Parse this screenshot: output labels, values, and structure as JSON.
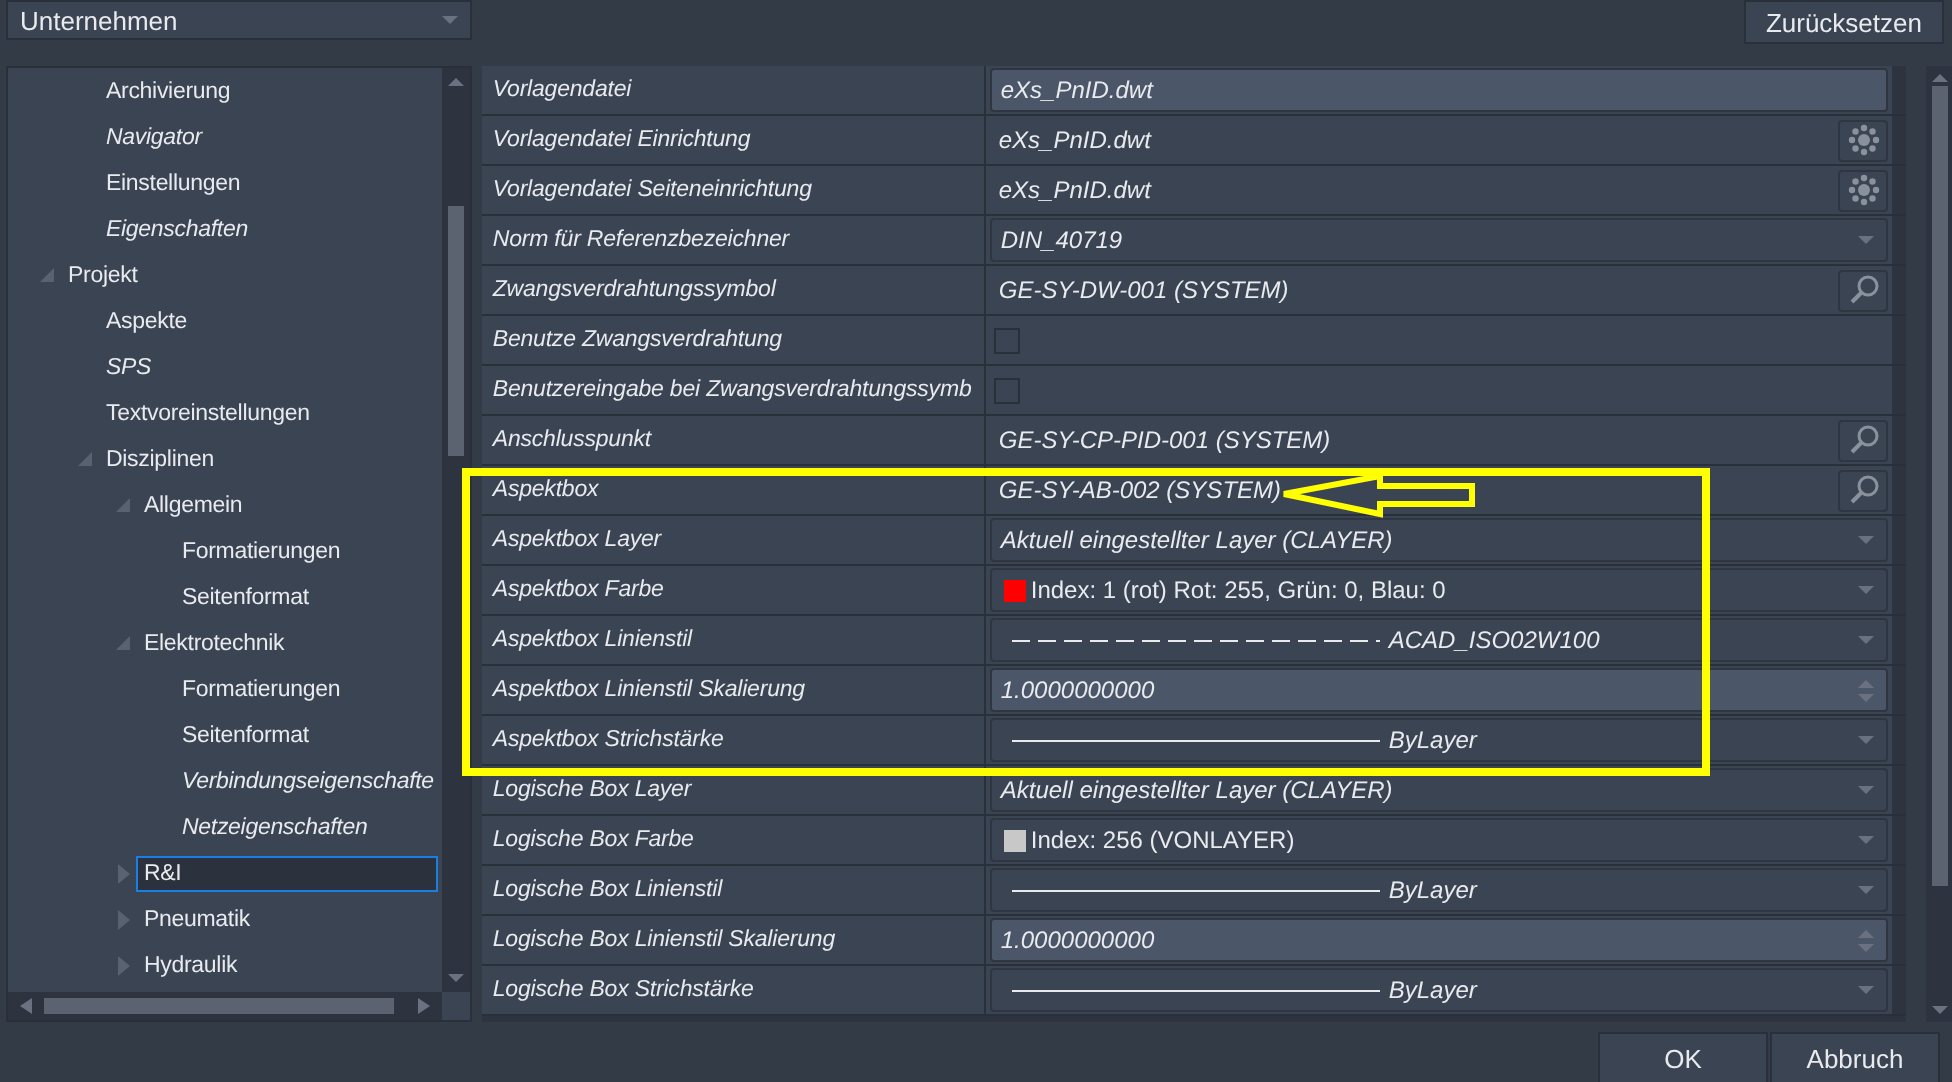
{
  "scope_dropdown": {
    "value": "Unternehmen"
  },
  "reset_button": "Zurücksetzen",
  "tree": {
    "continued_items": [
      {
        "label": "Archivierung",
        "italic": false,
        "selected": false
      },
      {
        "label": "Navigator",
        "italic": true,
        "selected": false
      },
      {
        "label": "Einstellungen",
        "italic": false,
        "selected": false
      },
      {
        "label": "Eigenschaften",
        "italic": true,
        "selected": false
      }
    ],
    "items": [
      {
        "label": "Projekt",
        "expanded": true,
        "italic": false,
        "selected": false,
        "children": [
          {
            "label": "Aspekte",
            "italic": false,
            "selected": false
          },
          {
            "label": "SPS",
            "italic": true,
            "selected": false
          },
          {
            "label": "Textvoreinstellungen",
            "italic": false,
            "selected": false
          },
          {
            "label": "Disziplinen",
            "expanded": true,
            "italic": false,
            "selected": false,
            "children": [
              {
                "label": "Allgemein",
                "expanded": true,
                "italic": false,
                "selected": false,
                "children": [
                  {
                    "label": "Formatierungen",
                    "italic": false,
                    "selected": false
                  },
                  {
                    "label": "Seitenformat",
                    "italic": false,
                    "selected": false
                  }
                ]
              },
              {
                "label": "Elektrotechnik",
                "expanded": true,
                "italic": false,
                "selected": false,
                "children": [
                  {
                    "label": "Formatierungen",
                    "italic": false,
                    "selected": false
                  },
                  {
                    "label": "Seitenformat",
                    "italic": false,
                    "selected": false
                  },
                  {
                    "label": "Verbindungseigenschafte",
                    "italic": true,
                    "selected": false
                  },
                  {
                    "label": "Netzeigenschaften",
                    "italic": true,
                    "selected": false
                  }
                ]
              },
              {
                "label": "R&I",
                "expanded": false,
                "italic": false,
                "selected": true
              },
              {
                "label": "Pneumatik",
                "expanded": false,
                "italic": false,
                "selected": false
              },
              {
                "label": "Hydraulik",
                "expanded": false,
                "italic": false,
                "selected": false
              }
            ]
          }
        ]
      }
    ]
  },
  "properties": [
    {
      "label": "Vorlagendatei",
      "kind": "field",
      "value": "eXs_PnID.dwt"
    },
    {
      "label": "Vorlagendatei Einrichtung",
      "kind": "browse",
      "value": "eXs_PnID.dwt"
    },
    {
      "label": "Vorlagendatei Seiteneinrichtung",
      "kind": "browse",
      "value": "eXs_PnID.dwt"
    },
    {
      "label": "Norm für Referenzbezeichner",
      "kind": "dropdown",
      "value": "DIN_40719"
    },
    {
      "label": "Zwangsverdrahtungssymbol",
      "kind": "lookup",
      "value": "GE-SY-DW-001 (SYSTEM)"
    },
    {
      "label": "Benutze Zwangsverdrahtung",
      "kind": "checkbox",
      "checked": false
    },
    {
      "label": "Benutzereingabe bei Zwangsverdrahtungssymb",
      "kind": "checkbox",
      "checked": false
    },
    {
      "label": "Anschlusspunkt",
      "kind": "lookup",
      "value": "GE-SY-CP-PID-001 (SYSTEM)"
    },
    {
      "label": "Aspektbox",
      "kind": "lookup",
      "value": "GE-SY-AB-002 (SYSTEM)"
    },
    {
      "label": "Aspektbox Layer",
      "kind": "dropdown",
      "value": "Aktuell eingestellter Layer (CLAYER)"
    },
    {
      "label": "Aspektbox Farbe",
      "kind": "color",
      "color": "#ff0000",
      "value": "Index: 1  (rot) Rot: 255, Grün: 0, Blau: 0"
    },
    {
      "label": "Aspektbox Linienstil",
      "kind": "line",
      "dashed": true,
      "value": "ACAD_ISO02W100"
    },
    {
      "label": "Aspektbox Linienstil Skalierung",
      "kind": "spinner",
      "value": "1.0000000000"
    },
    {
      "label": "Aspektbox Strichstärke",
      "kind": "line",
      "dashed": false,
      "value": "ByLayer"
    },
    {
      "label": "Logische Box Layer",
      "kind": "dropdown",
      "value": "Aktuell eingestellter Layer (CLAYER)"
    },
    {
      "label": "Logische Box Farbe",
      "kind": "color",
      "color": "#c8c8c8",
      "value": "Index: 256  (VONLAYER)"
    },
    {
      "label": "Logische Box Linienstil",
      "kind": "line",
      "dashed": false,
      "value": "ByLayer"
    },
    {
      "label": "Logische Box Linienstil Skalierung",
      "kind": "spinner",
      "value": "1.0000000000"
    },
    {
      "label": "Logische Box Strichstärke",
      "kind": "line",
      "dashed": false,
      "value": "ByLayer"
    }
  ],
  "buttons": [
    "OK",
    "Abbruch"
  ]
}
